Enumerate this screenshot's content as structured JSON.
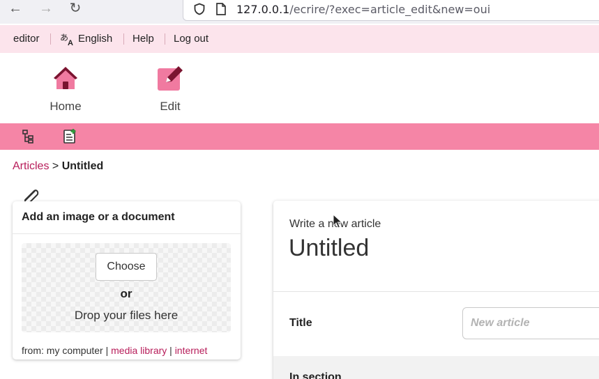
{
  "browser": {
    "url_host": "127.0.0.1",
    "url_rest": "/ecrire/?exec=article_edit&new=oui"
  },
  "userbar": {
    "user": "editor",
    "language": "English",
    "help": "Help",
    "logout": "Log out"
  },
  "mainnav": {
    "home": "Home",
    "edit": "Edit"
  },
  "breadcrumb": {
    "parent": "Articles",
    "separator": ">",
    "current": "Untitled"
  },
  "documents": {
    "title": "Add an image or a document",
    "choose": "Choose",
    "or": "or",
    "drop": "Drop your files here",
    "from_label": "from: my computer",
    "sep": "|",
    "media_library": "media library",
    "internet": "internet"
  },
  "article": {
    "subtitle": "Write a new article",
    "heading": "Untitled",
    "title_label": "Title",
    "title_placeholder": "New article",
    "section_label": "In section"
  },
  "colors": {
    "accent": "#f585a6",
    "userbar_bg": "#fce4ec",
    "link": "#b71d5a",
    "icon_pink": "#f07aa0",
    "icon_dark": "#7a1430"
  }
}
